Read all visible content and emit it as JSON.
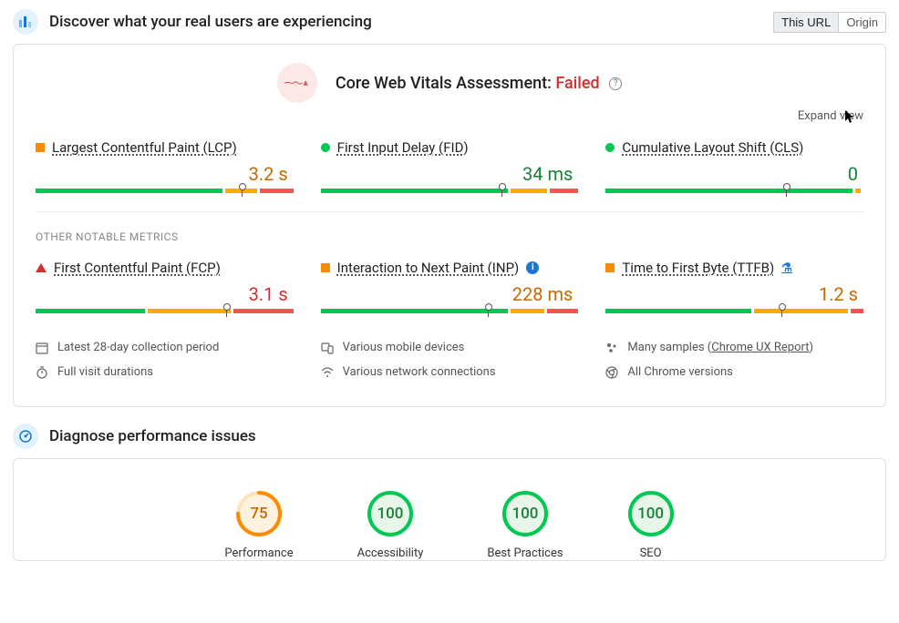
{
  "header": {
    "title": "Discover what your real users are experiencing",
    "toggle": {
      "this_url": "This URL",
      "origin": "Origin"
    }
  },
  "cwv": {
    "title_prefix": "Core Web Vitals Assessment: ",
    "status": "Failed",
    "expand": "Expand view"
  },
  "metrics_top": [
    {
      "name": "Largest Contentful Paint (LCP)",
      "value": "3.2 s",
      "status": "orange",
      "bar": {
        "g": 72,
        "o": 12,
        "r": 13,
        "marker": 80
      }
    },
    {
      "name": "First Input Delay (FID)",
      "value": "34 ms",
      "status": "green",
      "bar": {
        "g": 72,
        "o": 14,
        "r": 11,
        "marker": 70
      }
    },
    {
      "name": "Cumulative Layout Shift (CLS)",
      "value": "0",
      "status": "green",
      "bar": {
        "g": 96,
        "o": 2,
        "r": 0,
        "marker": 70
      }
    }
  ],
  "other_label": "OTHER NOTABLE METRICS",
  "metrics_other": [
    {
      "name": "First Contentful Paint (FCP)",
      "value": "3.1 s",
      "status": "red",
      "icon": "tri",
      "bar": {
        "g": 42,
        "o": 32,
        "r": 23,
        "marker": 74
      }
    },
    {
      "name": "Interaction to Next Paint (INP)",
      "value": "228 ms",
      "status": "orange",
      "icon": "sq",
      "badge": "info",
      "bar": {
        "g": 72,
        "o": 13,
        "r": 12,
        "marker": 65
      }
    },
    {
      "name": "Time to First Byte (TTFB)",
      "value": "1.2 s",
      "status": "orange",
      "icon": "sq",
      "badge": "flask",
      "bar": {
        "g": 56,
        "o": 36,
        "r": 5,
        "marker": 68
      }
    }
  ],
  "footer": {
    "col1": {
      "a": "Latest 28-day collection period",
      "b": "Full visit durations"
    },
    "col2": {
      "a": "Various mobile devices",
      "b": "Various network connections"
    },
    "col3": {
      "a_prefix": "Many samples (",
      "a_link": "Chrome UX Report",
      "a_suffix": ")",
      "b": "All Chrome versions"
    }
  },
  "diagnose": {
    "title": "Diagnose performance issues",
    "gauges": [
      {
        "label": "Performance",
        "value": "75",
        "pct": 75,
        "color": "orange"
      },
      {
        "label": "Accessibility",
        "value": "100",
        "pct": 100,
        "color": "green"
      },
      {
        "label": "Best Practices",
        "value": "100",
        "pct": 100,
        "color": "green"
      },
      {
        "label": "SEO",
        "value": "100",
        "pct": 100,
        "color": "green"
      }
    ]
  },
  "colors": {
    "green": "#00c853",
    "orange": "#ffab00",
    "red": "#ff5252",
    "gauge_orange": "#fb8c00",
    "gauge_green": "#00c853"
  }
}
